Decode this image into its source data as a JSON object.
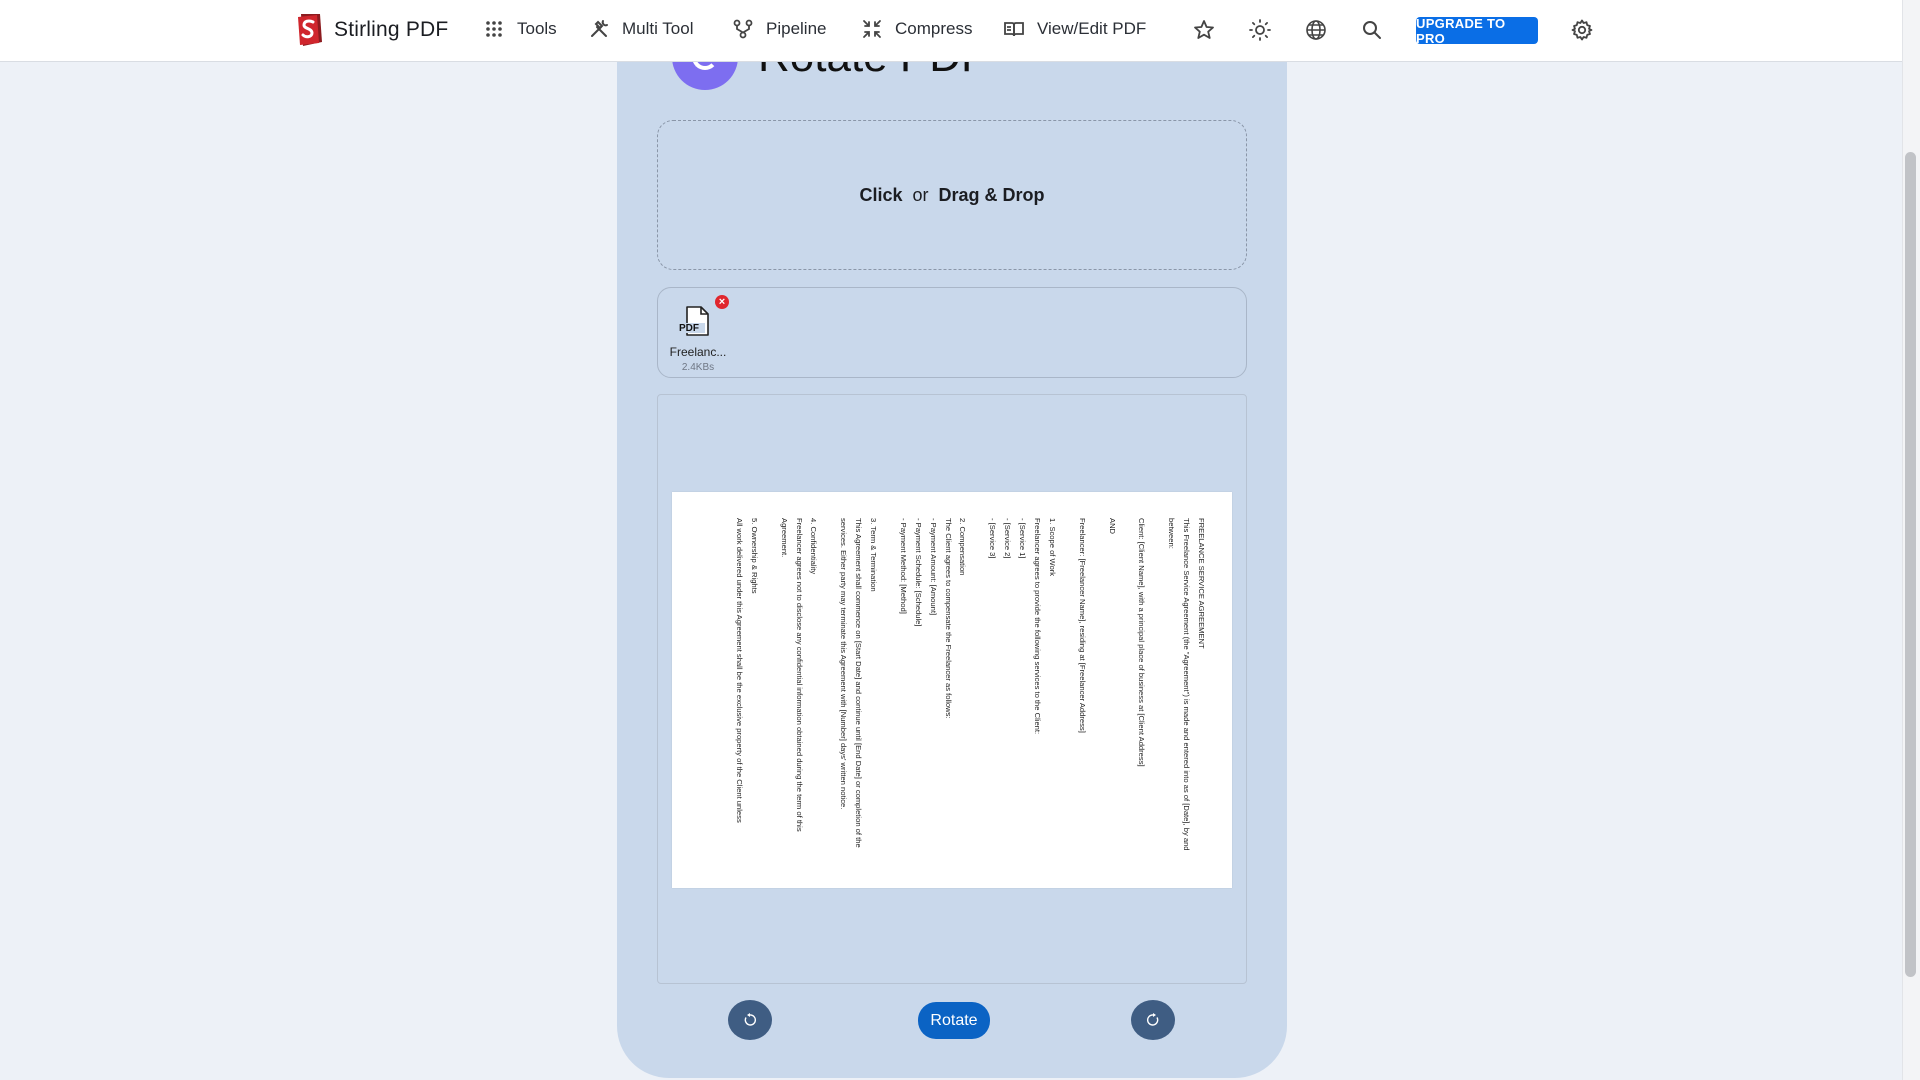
{
  "app": {
    "name": "Stirling PDF"
  },
  "nav": {
    "items": [
      {
        "label": "Tools"
      },
      {
        "label": "Multi Tool"
      },
      {
        "label": "Pipeline"
      },
      {
        "label": "Compress"
      },
      {
        "label": "View/Edit PDF"
      }
    ],
    "upgrade_label": "UPGRADE TO PRO"
  },
  "tool": {
    "title": "Rotate PDF"
  },
  "dropzone": {
    "click": "Click",
    "or": "or",
    "drag": "Drag & Drop"
  },
  "file": {
    "name": "Freelanc...",
    "size": "2.4KBs",
    "type_label": "PDF"
  },
  "actions": {
    "rotate_label": "Rotate"
  },
  "document": {
    "lines": [
      "FREELANCE SERVICE AGREEMENT",
      "This Freelance Service Agreement (the \"Agreement\") is made and entered into as of [Date], by and",
      "between:",
      "",
      "Client: [Client Name], with a principal place of business at [Client Address]",
      "",
      "AND",
      "",
      "Freelancer: [Freelancer Name], residing at [Freelancer Address]",
      "",
      "1. Scope of Work",
      "Freelancer agrees to provide the following services to the Client:",
      "- [Service 1]",
      "- [Service 2]",
      "- [Service 3]",
      "",
      "2. Compensation",
      "The Client agrees to compensate the Freelancer as follows:",
      "- Payment Amount: [Amount]",
      "- Payment Schedule: [Schedule]",
      "- Payment Method: [Method]",
      "",
      "3. Term & Termination",
      "This Agreement shall commence on [Start Date] and continue until [End Date] or completion of the",
      "services. Either party may terminate this Agreement with [Number] days' written notice.",
      "",
      "4. Confidentiality",
      "Freelancer agrees not to disclose any confidential information obtained during the term of this",
      "Agreement.",
      "",
      "5. Ownership & Rights",
      "All work delivered under this Agreement shall be the exclusive property of the Client unless"
    ]
  },
  "colors": {
    "accent": "#0a6ee6",
    "card": "#c9d8eb",
    "rotate_button": "#0b63c4",
    "round_button": "#3f5d83",
    "tool_icon": "#7d6ef0"
  },
  "icons": [
    "grid-icon",
    "wrench-hammer-icon",
    "pipeline-icon",
    "compress-icon",
    "book-icon",
    "star-icon",
    "sun-icon",
    "globe-icon",
    "search-icon",
    "gear-icon"
  ]
}
